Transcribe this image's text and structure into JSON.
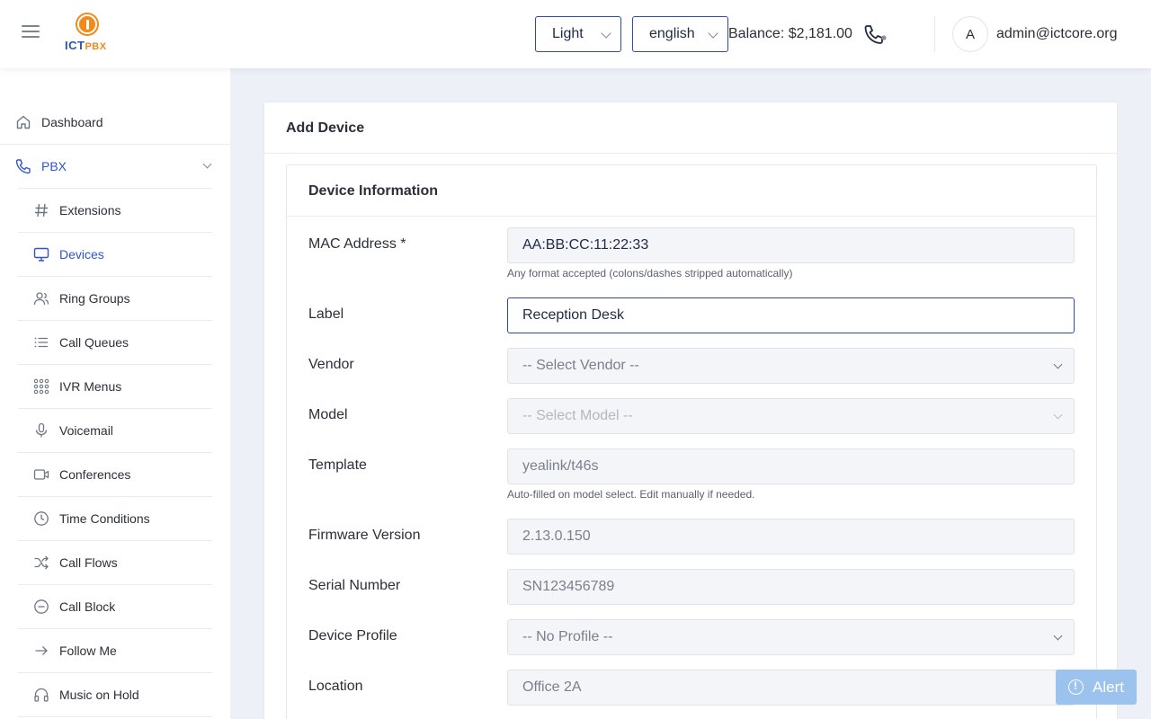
{
  "header": {
    "logo": {
      "text_a": "ICT",
      "text_b": "PBX"
    },
    "theme_select": "Light",
    "language_select": "english",
    "balance": "Balance: $2,181.00",
    "avatar_initial": "A",
    "user_email": "admin@ictcore.org"
  },
  "sidebar": {
    "dashboard": "Dashboard",
    "pbx": "PBX",
    "items": [
      {
        "label": "Extensions",
        "icon": "hash-icon"
      },
      {
        "label": "Devices",
        "icon": "monitor-icon",
        "active": true
      },
      {
        "label": "Ring Groups",
        "icon": "users-icon"
      },
      {
        "label": "Call Queues",
        "icon": "list-icon"
      },
      {
        "label": "IVR Menus",
        "icon": "grid-icon"
      },
      {
        "label": "Voicemail",
        "icon": "microphone-icon"
      },
      {
        "label": "Conferences",
        "icon": "video-icon"
      },
      {
        "label": "Time Conditions",
        "icon": "clock-icon"
      },
      {
        "label": "Call Flows",
        "icon": "shuffle-icon"
      },
      {
        "label": "Call Block",
        "icon": "block-icon"
      },
      {
        "label": "Follow Me",
        "icon": "arrow-right-icon"
      },
      {
        "label": "Music on Hold",
        "icon": "headphones-icon"
      }
    ],
    "active_color": "#2f55c9"
  },
  "main": {
    "card_title": "Add Device",
    "section_title": "Device Information",
    "fields": {
      "mac": {
        "label": "MAC Address *",
        "value": "AA:BB:CC:11:22:33",
        "help": "Any format accepted (colons/dashes stripped automatically)"
      },
      "label": {
        "label": "Label",
        "value": "Reception Desk"
      },
      "vendor": {
        "label": "Vendor",
        "value": "-- Select Vendor --"
      },
      "model": {
        "label": "Model",
        "value": "-- Select Model --"
      },
      "template": {
        "label": "Template",
        "value": "yealink/t46s",
        "help": "Auto-filled on model select. Edit manually if needed."
      },
      "firmware": {
        "label": "Firmware Version",
        "value": "2.13.0.150"
      },
      "serial": {
        "label": "Serial Number",
        "value": "SN123456789"
      },
      "profile": {
        "label": "Device Profile",
        "value": "-- No Profile --"
      },
      "location": {
        "label": "Location",
        "value": "Office 2A"
      }
    }
  },
  "alert_button": "Alert"
}
